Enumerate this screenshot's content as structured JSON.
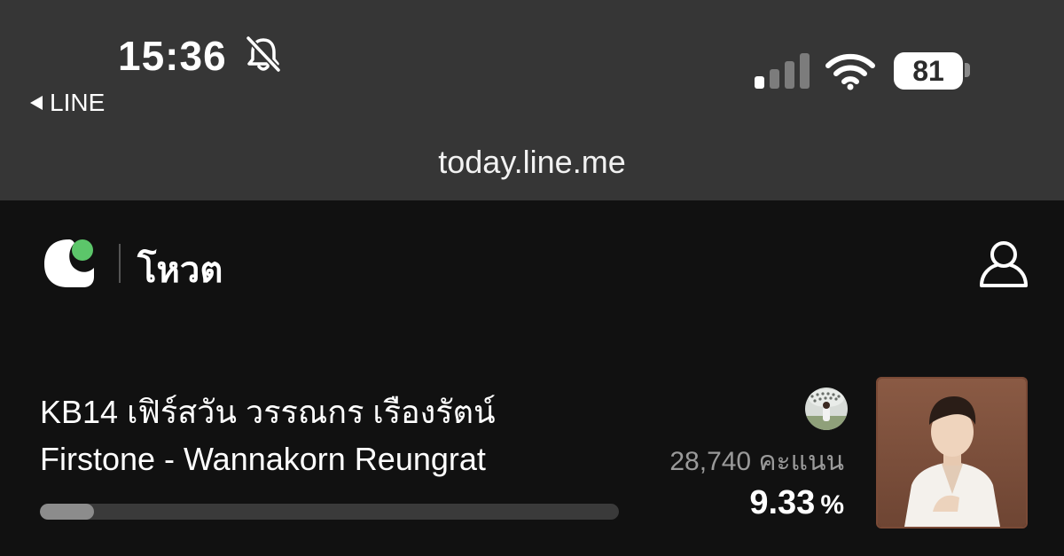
{
  "status_bar": {
    "time": "15:36",
    "back_app": "LINE",
    "battery_level": "81",
    "icons": [
      "bell-slash-icon",
      "cellular-signal-icon",
      "wifi-icon",
      "battery-icon"
    ]
  },
  "browser": {
    "url": "today.line.me"
  },
  "app_header": {
    "title": "โหวต",
    "icons": [
      "line-today-logo-icon",
      "profile-icon"
    ]
  },
  "vote_item": {
    "line1": "KB14 เฟิร์สวัน วรรณกร เรืองรัตน์",
    "line2": "Firstone - Wannakorn Reungrat",
    "votes": "28,740 คะแนน",
    "percent_value": "9.33",
    "percent_sign": "%",
    "progress_fraction": 0.0933
  },
  "colors": {
    "status_bg": "#363636",
    "page_bg": "#111111",
    "logo_green": "#5cc66a",
    "bar_track": "#3a3a3a",
    "bar_fill": "#8c8c8c"
  }
}
